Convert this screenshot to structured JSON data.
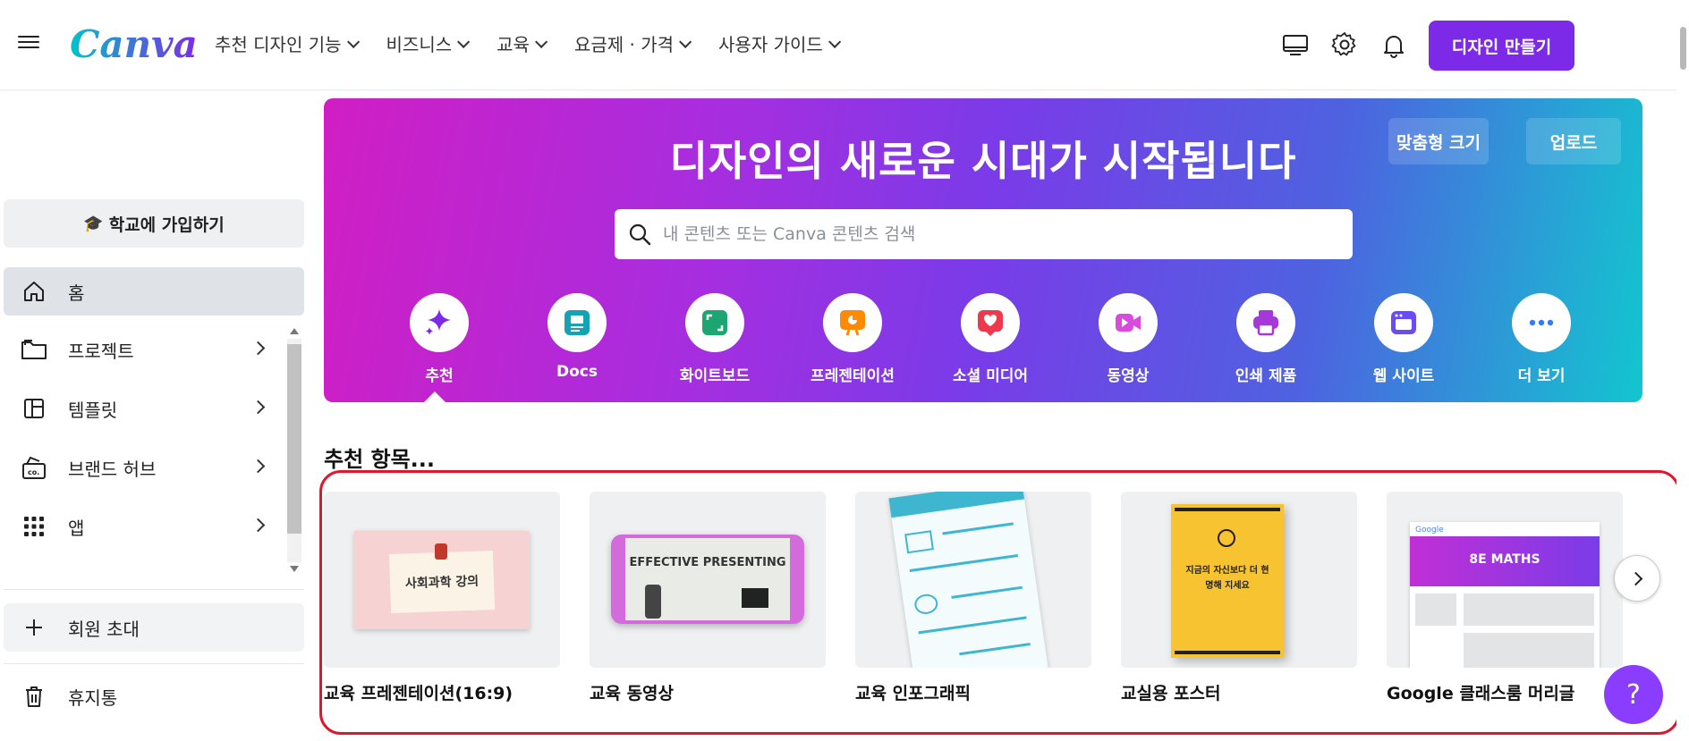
{
  "header": {
    "logo": "Canva",
    "nav": [
      {
        "label": "추천 디자인 기능"
      },
      {
        "label": "비즈니스"
      },
      {
        "label": "교육"
      },
      {
        "label": "요금제 · 가격"
      },
      {
        "label": "사용자 가이드"
      }
    ],
    "create_button": "디자인 만들기",
    "icons": [
      "desktop-icon",
      "settings-icon",
      "bell-icon"
    ]
  },
  "sidebar": {
    "join_school": "학교에 가입하기",
    "items": [
      {
        "label": "홈",
        "icon": "home-icon",
        "active": true
      },
      {
        "label": "프로젝트",
        "icon": "folder-icon"
      },
      {
        "label": "템플릿",
        "icon": "template-icon"
      },
      {
        "label": "브랜드 허브",
        "icon": "brand-hub-icon"
      },
      {
        "label": "앱",
        "icon": "apps-grid-icon"
      }
    ],
    "invite": "회원 초대",
    "trash": "휴지통"
  },
  "hero": {
    "title": "디자인의 새로운 시대가 시작됩니다",
    "custom_size_button": "맞춤형 크기",
    "upload_button": "업로드",
    "search_placeholder": "내 콘텐츠 또는 Canva 콘텐츠 검색",
    "categories": [
      {
        "label": "추천",
        "icon": "sparkle-icon",
        "color": "#7d2ae8"
      },
      {
        "label": "Docs",
        "icon": "docs-icon",
        "color": "#13a3b5"
      },
      {
        "label": "화이트보드",
        "icon": "whiteboard-icon",
        "color": "#1ea672"
      },
      {
        "label": "프레젠테이션",
        "icon": "presentation-icon",
        "color": "#ff8a00"
      },
      {
        "label": "소셜 미디어",
        "icon": "heart-icon",
        "color": "#f0384c"
      },
      {
        "label": "동영상",
        "icon": "video-icon",
        "color": "#d94adf"
      },
      {
        "label": "인쇄 제품",
        "icon": "printer-icon",
        "color": "#a637d9"
      },
      {
        "label": "웹 사이트",
        "icon": "website-icon",
        "color": "#6a4cf0"
      },
      {
        "label": "더 보기",
        "icon": "more-icon",
        "color": "#2f7df2"
      }
    ]
  },
  "recommended": {
    "title": "추천 항목...",
    "cards": [
      {
        "label": "교육 프레젠테이션(16:9)",
        "thumb_text": "사회과학 강의"
      },
      {
        "label": "교육 동영상",
        "thumb_text": "EFFECTIVE PRESENTING"
      },
      {
        "label": "교육 인포그래픽",
        "thumb_text": ""
      },
      {
        "label": "교실용 포스터",
        "thumb_text": "지금의 자신보다 더 현명해 지세요"
      },
      {
        "label": "Google 클래스룸 머리글",
        "thumb_text": "8E MATHS"
      }
    ]
  },
  "help_button": "?"
}
